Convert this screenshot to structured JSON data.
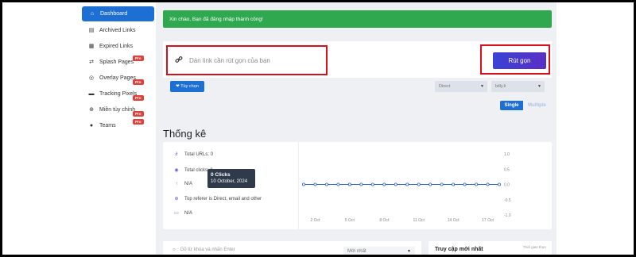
{
  "sidebar": {
    "items": [
      {
        "label": "Dashboard",
        "icon": "home-icon",
        "active": true
      },
      {
        "label": "Archived Links",
        "icon": "archive-icon"
      },
      {
        "label": "Expired Links",
        "icon": "calendar-icon"
      },
      {
        "label": "Splash Pages",
        "icon": "splash-icon",
        "badge": "Pro"
      },
      {
        "label": "Overlay Pages",
        "icon": "overlay-icon",
        "badge": "Pro"
      },
      {
        "label": "Tracking Pixels",
        "icon": "pixel-icon",
        "badge": "Pro"
      },
      {
        "label": "Miền tùy chỉnh",
        "icon": "globe-icon",
        "badge": "Pro"
      },
      {
        "label": "Teams",
        "icon": "user-icon",
        "badge": "Pro"
      }
    ]
  },
  "alert": {
    "text": "Xin chào, Bạn đã đăng nhập thành công!"
  },
  "shorten": {
    "placeholder": "Dán link cần rút gọn của bạn",
    "button_label": "Rút gọn",
    "options_label": "❤ Tùy chọn",
    "redirect_select": "Direct",
    "domain_select": "bitly.li",
    "mode_single": "Single",
    "mode_multiple": "Multiple"
  },
  "stats": {
    "title": "Thống kê",
    "rows": [
      {
        "icon": "link-icon",
        "text": "Total URLs: 0"
      },
      {
        "icon": "eye-icon",
        "text": "Total clicks: 0"
      },
      {
        "icon": "pin-icon",
        "text": "N/A"
      },
      {
        "icon": "globe-icon",
        "text": "Top referer is Direct, email and other"
      },
      {
        "icon": "monitor-icon",
        "text": "N/A"
      }
    ]
  },
  "tooltip": {
    "clicks": "0 Clicks",
    "date": "10 October, 2024"
  },
  "chart_data": {
    "type": "line",
    "x": [
      "1 Oct",
      "2 Oct",
      "3 Oct",
      "4 Oct",
      "5 Oct",
      "6 Oct",
      "7 Oct",
      "8 Oct",
      "9 Oct",
      "10 Oct",
      "11 Oct",
      "12 Oct",
      "13 Oct",
      "14 Oct",
      "15 Oct",
      "16 Oct",
      "17 Oct",
      "18 Oct"
    ],
    "values": [
      0,
      0,
      0,
      0,
      0,
      0,
      0,
      0,
      0,
      0,
      0,
      0,
      0,
      0,
      0,
      0,
      0,
      0
    ],
    "xticks": [
      "2 Oct",
      "5 Oct",
      "8 Oct",
      "11 Oct",
      "14 Oct",
      "17 Oct"
    ],
    "yticks": [
      "1.0",
      "0.5",
      "0.0",
      "-0.5",
      "-1.0"
    ],
    "ylim": [
      -1,
      1
    ],
    "color": "#2e63c4"
  },
  "bottom": {
    "search_placeholder": "Gõ từ khóa và nhấn Enter",
    "sort_label": "Mới nhất",
    "recent_title": "Truy cập mới nhất",
    "recent_sub": "Thời gian thực"
  }
}
